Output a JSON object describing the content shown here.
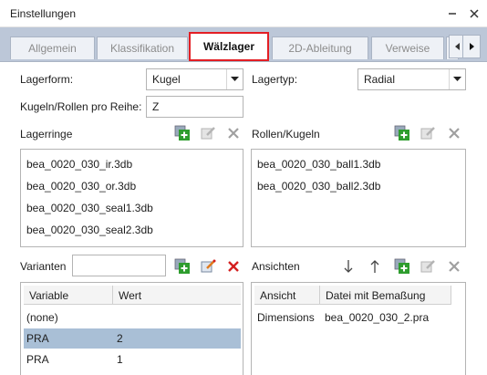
{
  "window": {
    "title": "Einstellungen"
  },
  "tabs": [
    "Allgemein",
    "Klassifikation",
    "Wälzlager",
    "2D-Ableitung",
    "Verweise"
  ],
  "form": {
    "lagerform_label": "Lagerform:",
    "lagerform_value": "Kugel",
    "lagertyp_label": "Lagertyp:",
    "lagertyp_value": "Radial",
    "kugeln_label": "Kugeln/Rollen pro Reihe:",
    "kugeln_value": "Z"
  },
  "lagerringe": {
    "label": "Lagerringe",
    "items": [
      "bea_0020_030_ir.3db",
      "bea_0020_030_or.3db",
      "bea_0020_030_seal1.3db",
      "bea_0020_030_seal2.3db"
    ]
  },
  "rollen": {
    "label": "Rollen/Kugeln",
    "items": [
      "bea_0020_030_ball1.3db",
      "bea_0020_030_ball2.3db"
    ]
  },
  "varianten": {
    "label": "Varianten",
    "input_value": "",
    "columns": [
      "Variable",
      "Wert"
    ],
    "rows": [
      {
        "variable": "(none)",
        "wert": ""
      },
      {
        "variable": "PRA",
        "wert": "2"
      },
      {
        "variable": "PRA",
        "wert": "1"
      }
    ]
  },
  "ansichten": {
    "label": "Ansichten",
    "columns": [
      "Ansicht",
      "Datei mit Bemaßung"
    ],
    "rows": [
      {
        "ansicht": "Dimensions",
        "datei": "bea_0020_030_2.pra"
      }
    ]
  },
  "colors": {
    "tabstrip": "#bcc7d8",
    "active_tab_border": "#e31e24",
    "selected_row": "#a9bfd6",
    "add_green": "#2e9d2e",
    "delete_red": "#d42020"
  }
}
